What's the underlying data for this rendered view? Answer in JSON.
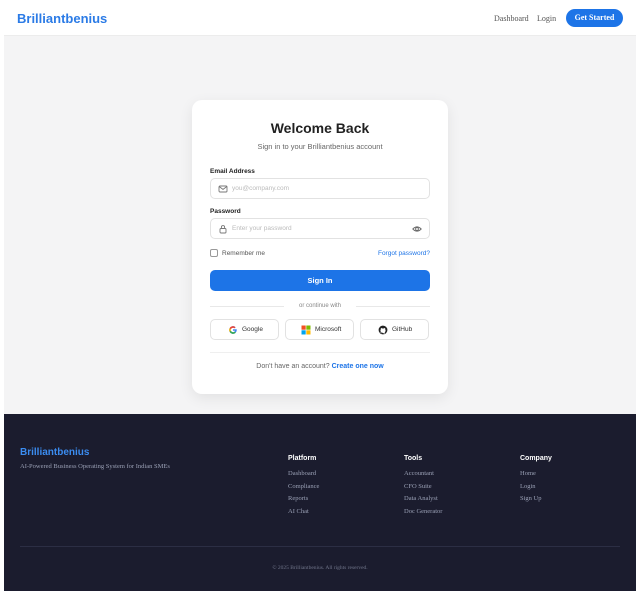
{
  "header": {
    "brand": "Brilliantbenius",
    "nav": [
      "Dashboard",
      "Login"
    ],
    "cta_label": "Get Started"
  },
  "card": {
    "title": "Welcome Back",
    "subtitle": "Sign in to your Brilliantbenius account",
    "email_label": "Email Address",
    "email_placeholder": "you@company.com",
    "password_label": "Password",
    "password_placeholder": "Enter your password",
    "remember_label": "Remember me",
    "forgot_label": "Forgot password?",
    "signin_label": "Sign In",
    "divider_text": "or continue with",
    "social": [
      "Google",
      "Microsoft",
      "GitHub"
    ],
    "signup_prompt": "Don't have an account?",
    "signup_link": "Create one now"
  },
  "footer": {
    "brand": "Brilliantbenius",
    "tagline": "AI-Powered Business Operating System for Indian SMEs",
    "columns": [
      {
        "title": "Platform",
        "links": [
          "Dashboard",
          "Compliance",
          "Reports",
          "AI Chat"
        ]
      },
      {
        "title": "Tools",
        "links": [
          "Accountant",
          "CFO Suite",
          "Data Analyst",
          "Doc Generator"
        ]
      },
      {
        "title": "Company",
        "links": [
          "Home",
          "Login",
          "Sign Up"
        ]
      }
    ],
    "copyright": "© 2025 Brilliantbenius. All rights reserved."
  },
  "colors": {
    "accent": "#1d74e7",
    "brand": "#2b7be6",
    "footer_bg": "#1b1c2e",
    "page_bg": "#f4f4f5"
  },
  "icons": {
    "email": "mail-icon",
    "password": "lock-icon",
    "visibility": "eye-icon",
    "google": "google-icon",
    "microsoft": "microsoft-icon",
    "github": "github-icon"
  }
}
